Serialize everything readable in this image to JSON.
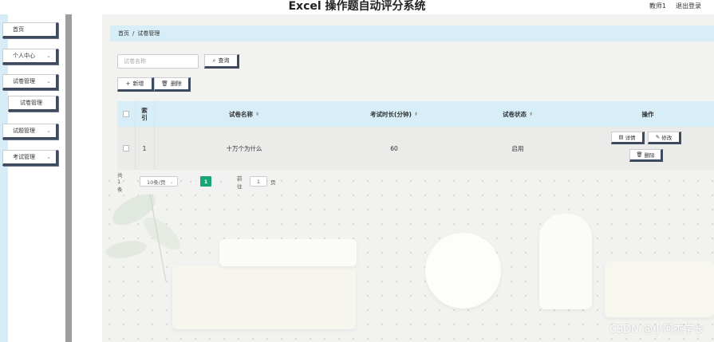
{
  "header": {
    "title": "Excel 操作题自动评分系统",
    "user": "教师1",
    "logout": "退出登录"
  },
  "sidebar": {
    "items": [
      {
        "label": "首页",
        "has_chevron": false
      },
      {
        "label": "个人中心",
        "has_chevron": true
      },
      {
        "label": "试卷管理",
        "has_chevron": true
      },
      {
        "label": "试卷管理",
        "has_chevron": false
      },
      {
        "label": "试题管理",
        "has_chevron": true
      },
      {
        "label": "考试管理",
        "has_chevron": true
      }
    ]
  },
  "breadcrumb": {
    "home": "首页",
    "separator": "/",
    "current": "试卷管理"
  },
  "search": {
    "placeholder": "试卷名称",
    "button": "查询"
  },
  "actions": {
    "add": "新增",
    "delete": "删除"
  },
  "table": {
    "columns": [
      "索引",
      "试卷名称",
      "考试时长(分钟)",
      "试卷状态",
      "操作"
    ],
    "index_header_line1": "索",
    "index_header_line2": "引",
    "rows": [
      {
        "index": "1",
        "name": "十万个为什么",
        "duration": "60",
        "status": "启用"
      }
    ],
    "row_actions": {
      "detail": "详情",
      "edit": "修改",
      "delete": "删除"
    }
  },
  "pagination": {
    "total": "共 1 条",
    "page_size": "10条/页",
    "current_page": "1",
    "goto_label": "前往",
    "goto_value": "1",
    "page_unit": "页"
  },
  "watermark": "CSDN @小阿杰学长",
  "colors": {
    "accent": "#17a675",
    "header_bg": "#d7edf7",
    "button_border": "#3e4a5e",
    "sidebar_divider": "#9e9e9e"
  },
  "icons": {
    "search": "search-icon",
    "add": "plus-icon",
    "delete": "trash-icon",
    "detail": "document-icon",
    "edit": "pencil-icon",
    "chevron": "chevron-down-icon"
  }
}
